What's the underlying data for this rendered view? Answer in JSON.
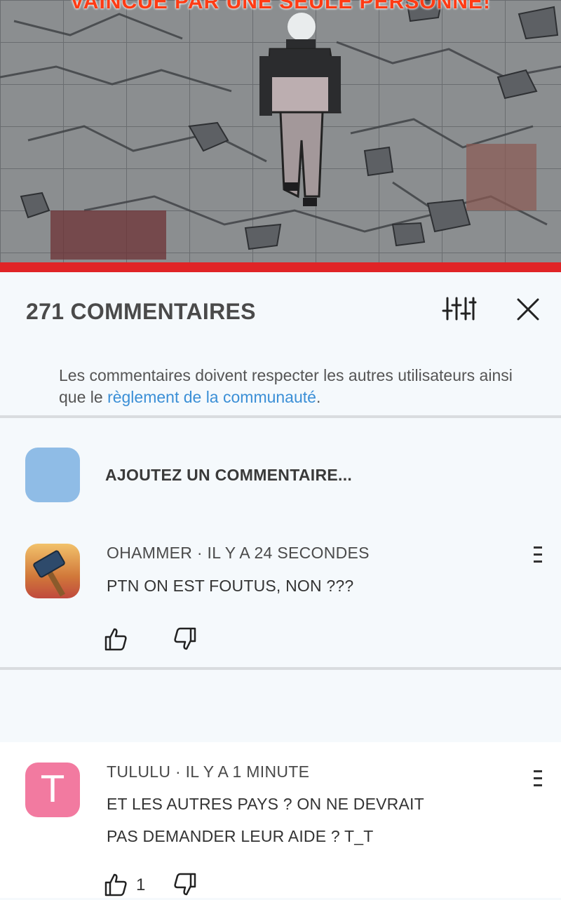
{
  "banner": {
    "caption": "VAINCUE PAR UNE SEULE PERSONNE!"
  },
  "comments_panel": {
    "title": "271 COMMENTAIRES",
    "notice_prefix": "Les commentaires doivent respecter les autres utilisateurs ainsi que le ",
    "notice_link": "règlement de la communauté",
    "notice_suffix": ".",
    "add_comment_placeholder": "AJOUTEZ UN COMMENTAIRE...",
    "filter_icon": "sliders-icon",
    "close_icon": "close-icon"
  },
  "comments": [
    {
      "author": "OHAMMER",
      "time": "IL Y A 24 SECONDES",
      "meta": "OHAMMER · IL Y A 24 SECONDES",
      "lines": [
        "PTN ON EST FOUTUS, NON ???"
      ],
      "likes": "",
      "avatar_icon": "hammer-icon"
    },
    {
      "author": "TULULU",
      "time": "IL Y A 1 MINUTE",
      "meta": "TULULU · IL Y A 1 MINUTE",
      "lines": [
        "ET LES AUTRES PAYS ? ON NE DEVRAIT",
        "PAS DEMANDER LEUR AIDE ? T_T"
      ],
      "likes": "1",
      "avatar_letter": "T",
      "avatar_color": "#f27aa0"
    }
  ],
  "colors": {
    "accent_red": "#e02426",
    "link_blue": "#3b8fd6",
    "panel_bg": "#f5f9fc"
  }
}
